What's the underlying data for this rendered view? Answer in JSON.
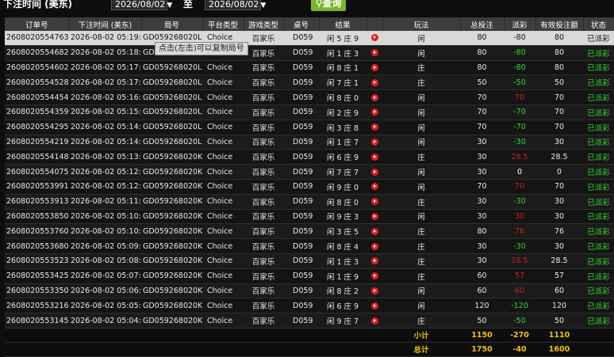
{
  "filter": {
    "time_label": "下注时间 (美东)",
    "start_date": "2026/08/02",
    "to_label": "至",
    "end_date": "2026/08/02",
    "query_label": "查询"
  },
  "columns": [
    "订单号",
    "下注时间 (美东)",
    "局号",
    "平台类型",
    "游戏类型",
    "桌号",
    "结果",
    "",
    "玩法",
    "总投注",
    "派彩",
    "有效投注额",
    "状态"
  ],
  "tooltip": "点击(左击)可以复制局号",
  "rows": [
    {
      "order": "260802055476376",
      "time": "2026-08-02 05:19:23",
      "ju": "GD059268020L7",
      "platform": "Choice",
      "game": "百家乐",
      "table": "D059",
      "result": "闲 5 庄 9",
      "play": "闲",
      "bet": "80",
      "payout": "-80",
      "payout_color": "neg",
      "valid": "80",
      "status": "已派彩",
      "selected": true
    },
    {
      "order": "260802055468249",
      "time": "2026-08-02 05:18:35",
      "ju": "GD059268020L6",
      "platform": "Choice",
      "game": "百家乐",
      "table": "D059",
      "result": "闲 1 庄 3",
      "play": "闲",
      "bet": "80",
      "payout": "-80",
      "payout_color": "neg",
      "valid": "80",
      "status": "已派彩"
    },
    {
      "order": "260802055460246",
      "time": "2026-08-02 05:17:55",
      "ju": "GD059268020L5",
      "platform": "Choice",
      "game": "百家乐",
      "table": "D059",
      "result": "闲 8 庄 1",
      "play": "庄",
      "bet": "80",
      "payout": "-80",
      "payout_color": "neg",
      "valid": "80",
      "status": "已派彩"
    },
    {
      "order": "260802055452855",
      "time": "2026-08-02 05:17:07",
      "ju": "GD059268020L4",
      "platform": "Choice",
      "game": "百家乐",
      "table": "D059",
      "result": "闲 7 庄 1",
      "play": "庄",
      "bet": "50",
      "payout": "-50",
      "payout_color": "neg",
      "valid": "50",
      "status": "已派彩"
    },
    {
      "order": "260802055445414",
      "time": "2026-08-02 05:16:24",
      "ju": "GD059268020L3",
      "platform": "Choice",
      "game": "百家乐",
      "table": "D059",
      "result": "闲 8 庄 0",
      "play": "闲",
      "bet": "70",
      "payout": "70",
      "payout_color": "red",
      "valid": "70",
      "status": "已派彩"
    },
    {
      "order": "260802055435992",
      "time": "2026-08-02 05:15:26",
      "ju": "GD059268020L2",
      "platform": "Choice",
      "game": "百家乐",
      "table": "D059",
      "result": "闲 2 庄 9",
      "play": "闲",
      "bet": "70",
      "payout": "-70",
      "payout_color": "neg",
      "valid": "70",
      "status": "已派彩"
    },
    {
      "order": "260802055429520",
      "time": "2026-08-02 05:14:49",
      "ju": "GD059268020L1",
      "platform": "Choice",
      "game": "百家乐",
      "table": "D059",
      "result": "闲 3 庄 8",
      "play": "闲",
      "bet": "70",
      "payout": "-70",
      "payout_color": "neg",
      "valid": "70",
      "status": "已派彩"
    },
    {
      "order": "260802055421905",
      "time": "2026-08-02 05:14:08",
      "ju": "GD059268020L0",
      "platform": "Choice",
      "game": "百家乐",
      "table": "D059",
      "result": "闲 1 庄 7",
      "play": "闲",
      "bet": "30",
      "payout": "-30",
      "payout_color": "neg",
      "valid": "30",
      "status": "已派彩"
    },
    {
      "order": "260802055414893",
      "time": "2026-08-02 05:13:32",
      "ju": "GD059268020KZ",
      "platform": "Choice",
      "game": "百家乐",
      "table": "D059",
      "result": "闲 6 庄 9",
      "play": "庄",
      "bet": "30",
      "payout": "28.5",
      "payout_color": "red",
      "valid": "28.5",
      "status": "已派彩"
    },
    {
      "order": "260802055407525",
      "time": "2026-08-02 05:12:52",
      "ju": "GD059268020KY",
      "platform": "Choice",
      "game": "百家乐",
      "table": "D059",
      "result": "闲 7 庄 7",
      "play": "闲",
      "bet": "30",
      "payout": "0",
      "payout_color": "zero",
      "valid": "0",
      "status": "已派彩"
    },
    {
      "order": "260802055399151",
      "time": "2026-08-02 05:12:09",
      "ju": "GD059268020KX",
      "platform": "Choice",
      "game": "百家乐",
      "table": "D059",
      "result": "闲 9 庄 0",
      "play": "闲",
      "bet": "70",
      "payout": "70",
      "payout_color": "red",
      "valid": "70",
      "status": "已派彩"
    },
    {
      "order": "260802055391365",
      "time": "2026-08-02 05:11:31",
      "ju": "GD059268020KW",
      "platform": "Choice",
      "game": "百家乐",
      "table": "D059",
      "result": "闲 8 庄 0",
      "play": "庄",
      "bet": "30",
      "payout": "-30",
      "payout_color": "neg",
      "valid": "30",
      "status": "已派彩"
    },
    {
      "order": "260802055385071",
      "time": "2026-08-02 05:10:58",
      "ju": "GD059268020KV",
      "platform": "Choice",
      "game": "百家乐",
      "table": "D059",
      "result": "闲 9 庄 3",
      "play": "闲",
      "bet": "30",
      "payout": "30",
      "payout_color": "red",
      "valid": "30",
      "status": "已派彩"
    },
    {
      "order": "260802055376066",
      "time": "2026-08-02 05:10:12",
      "ju": "GD059268020KU",
      "platform": "Choice",
      "game": "百家乐",
      "table": "D059",
      "result": "闲 3 庄 5",
      "play": "庄",
      "bet": "80",
      "payout": "76",
      "payout_color": "red",
      "valid": "76",
      "status": "已派彩"
    },
    {
      "order": "260802055368034",
      "time": "2026-08-02 05:09:32",
      "ju": "GD059268020KT",
      "platform": "Choice",
      "game": "百家乐",
      "table": "D059",
      "result": "闲 8 庄 4",
      "play": "庄",
      "bet": "30",
      "payout": "-30",
      "payout_color": "neg",
      "valid": "30",
      "status": "已派彩"
    },
    {
      "order": "260802055352373",
      "time": "2026-08-02 05:08:07",
      "ju": "GD059268020KR",
      "platform": "Choice",
      "game": "百家乐",
      "table": "D059",
      "result": "闲 1 庄 3",
      "play": "庄",
      "bet": "30",
      "payout": "28.5",
      "payout_color": "red",
      "valid": "28.5",
      "status": "已派彩"
    },
    {
      "order": "260802055342572",
      "time": "2026-08-02 05:07:20",
      "ju": "GD059268020KQ",
      "platform": "Choice",
      "game": "百家乐",
      "table": "D059",
      "result": "闲 1 庄 9",
      "play": "庄",
      "bet": "60",
      "payout": "57",
      "payout_color": "red",
      "valid": "57",
      "status": "已派彩"
    },
    {
      "order": "260802055335062",
      "time": "2026-08-02 05:06:42",
      "ju": "GD059268020KP",
      "platform": "Choice",
      "game": "百家乐",
      "table": "D059",
      "result": "闲 8 庄 2",
      "play": "闲",
      "bet": "60",
      "payout": "60",
      "payout_color": "red",
      "valid": "60",
      "status": "已派彩"
    },
    {
      "order": "260802055321640",
      "time": "2026-08-02 05:05:26",
      "ju": "GD059268020KN",
      "platform": "Choice",
      "game": "百家乐",
      "table": "D059",
      "result": "闲 6 庄 9",
      "play": "闲",
      "bet": "120",
      "payout": "-120",
      "payout_color": "neg",
      "valid": "120",
      "status": "已派彩"
    },
    {
      "order": "260802055314506",
      "time": "2026-08-02 05:04:45",
      "ju": "GD059268020KM",
      "platform": "Choice",
      "game": "百家乐",
      "table": "D059",
      "result": "闲 9 庄 7",
      "play": "庄",
      "bet": "50",
      "payout": "-50",
      "payout_color": "neg",
      "valid": "50",
      "status": "已派彩"
    }
  ],
  "subtotal": {
    "label": "小计",
    "bet": "1150",
    "payout": "-270",
    "valid": "1110"
  },
  "total": {
    "label": "总计",
    "bet": "1750",
    "payout": "-40",
    "valid": "1600"
  }
}
